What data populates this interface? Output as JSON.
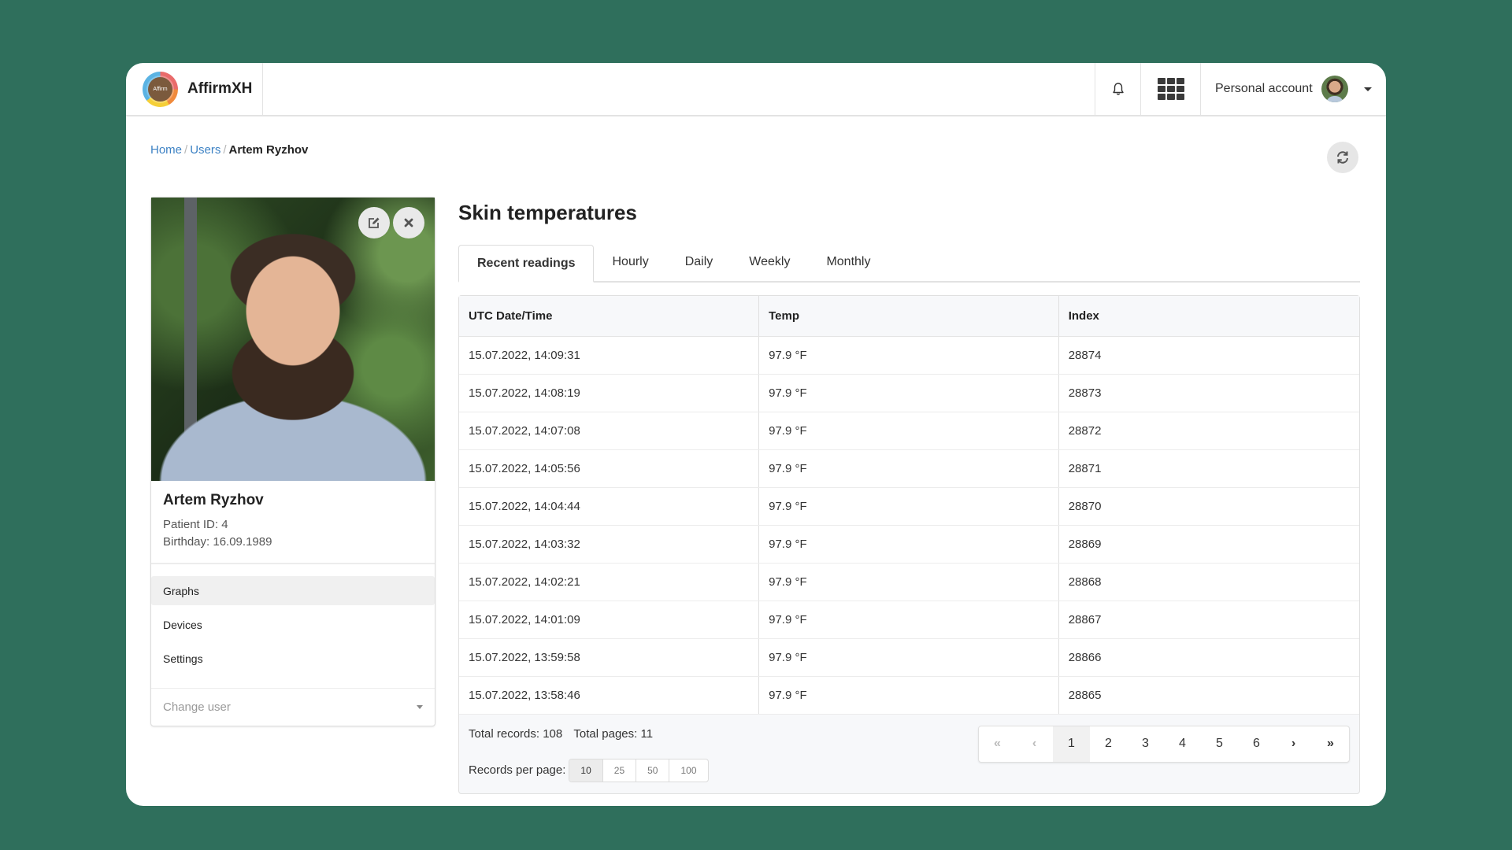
{
  "app": {
    "name": "AffirmXH",
    "logo_text": "Affirm"
  },
  "header": {
    "notifications_icon": "bell-icon",
    "apps_icon": "grid-icon",
    "account_label": "Personal account"
  },
  "breadcrumb": {
    "items": [
      {
        "label": "Home"
      },
      {
        "label": "Users"
      }
    ],
    "current": "Artem Ryzhov",
    "separator": "/"
  },
  "profile": {
    "name": "Artem Ryzhov",
    "patient_id": "Patient ID: 4",
    "birthday": "Birthday: 16.09.1989",
    "nav": [
      {
        "label": "Graphs",
        "active": true
      },
      {
        "label": "Devices",
        "active": false
      },
      {
        "label": "Settings",
        "active": false
      }
    ],
    "change_user_placeholder": "Change user"
  },
  "main": {
    "title": "Skin temperatures",
    "tabs": [
      {
        "label": "Recent readings",
        "active": true
      },
      {
        "label": "Hourly",
        "active": false
      },
      {
        "label": "Daily",
        "active": false
      },
      {
        "label": "Weekly",
        "active": false
      },
      {
        "label": "Monthly",
        "active": false
      }
    ],
    "table": {
      "columns": [
        "UTC Date/Time",
        "Temp",
        "Index"
      ],
      "rows": [
        [
          "15.07.2022, 14:09:31",
          "97.9 °F",
          "28874"
        ],
        [
          "15.07.2022, 14:08:19",
          "97.9 °F",
          "28873"
        ],
        [
          "15.07.2022, 14:07:08",
          "97.9 °F",
          "28872"
        ],
        [
          "15.07.2022, 14:05:56",
          "97.9 °F",
          "28871"
        ],
        [
          "15.07.2022, 14:04:44",
          "97.9 °F",
          "28870"
        ],
        [
          "15.07.2022, 14:03:32",
          "97.9 °F",
          "28869"
        ],
        [
          "15.07.2022, 14:02:21",
          "97.9 °F",
          "28868"
        ],
        [
          "15.07.2022, 14:01:09",
          "97.9 °F",
          "28867"
        ],
        [
          "15.07.2022, 13:59:58",
          "97.9 °F",
          "28866"
        ],
        [
          "15.07.2022, 13:58:46",
          "97.9 °F",
          "28865"
        ]
      ]
    },
    "footer": {
      "total_records": "Total records: 108",
      "total_pages": "Total pages: 11",
      "records_per_page_label": "Records per page:",
      "records_per_page_options": [
        "10",
        "25",
        "50",
        "100"
      ],
      "records_per_page_selected": "10"
    },
    "pagination": {
      "first": "«",
      "prev": "‹",
      "pages": [
        "1",
        "2",
        "3",
        "4",
        "5",
        "6"
      ],
      "current": "1",
      "next": "›",
      "last": "»"
    }
  }
}
